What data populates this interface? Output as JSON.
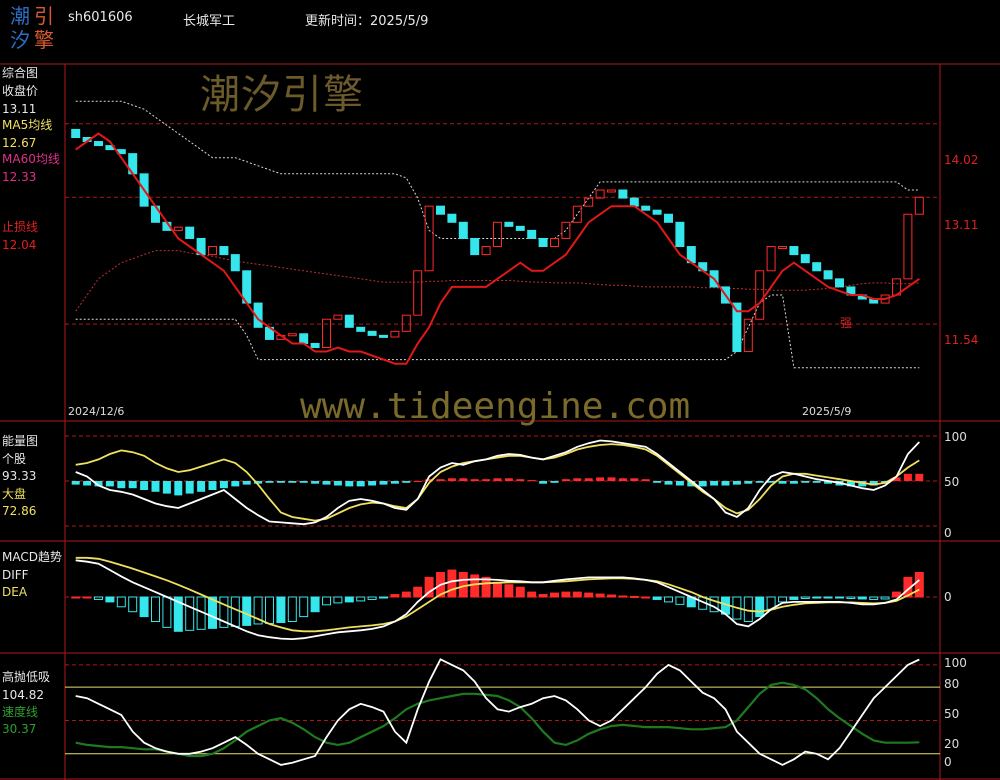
{
  "header": {
    "code": "sh601606",
    "name": "长城军工",
    "update_label": "更新时间：",
    "update_date": "2025/5/9"
  },
  "logo": {
    "chars": [
      "潮",
      "引",
      "汐",
      "擎"
    ]
  },
  "watermark": {
    "brand": "潮汐引擎",
    "url": "www.tideengine.com"
  },
  "panel1": {
    "title": "综合图",
    "close_label": "收盘价",
    "close_value": "13.11",
    "ma5_label": "MA5均线",
    "ma5_value": "12.67",
    "ma60_label": "MA60均线",
    "ma60_value": "12.33",
    "stop_label": "止损线",
    "stop_value": "12.04",
    "strong_marker": "强",
    "date_start": "2024/12/6",
    "date_end": "2025/5/9",
    "axis": [
      "14.02",
      "13.11",
      "11.54"
    ]
  },
  "panel2": {
    "title": "能量图",
    "stock_label": "个股",
    "stock_value": "93.33",
    "market_label": "大盘",
    "market_value": "72.86",
    "axis": [
      "100",
      "50",
      "0"
    ]
  },
  "panel3": {
    "title": "MACD趋势",
    "diff_label": "DIFF",
    "dea_label": "DEA",
    "axis": [
      "0"
    ]
  },
  "panel4": {
    "title": "高抛低吸",
    "value1": "104.82",
    "speed_label": "速度线",
    "speed_value": "30.37",
    "axis": [
      "100",
      "80",
      "50",
      "20",
      "0"
    ]
  },
  "colors": {
    "up": "#ff2a2a",
    "down": "#35e6ec",
    "ma5": "#e01818",
    "ma60": "#c03030",
    "white": "#ffffff",
    "yellow": "#f0e060",
    "green": "#1f7a1f",
    "grid": "#b01818"
  },
  "chart_data": [
    {
      "type": "candlestick",
      "name": "综合图",
      "ylim": [
        10.6,
        14.5
      ],
      "x_range": [
        0,
        64
      ],
      "close": [
        13.85,
        13.8,
        13.75,
        13.7,
        13.65,
        13.4,
        13.0,
        12.8,
        12.7,
        12.74,
        12.6,
        12.4,
        12.5,
        12.4,
        12.2,
        11.8,
        11.5,
        11.35,
        11.4,
        11.42,
        11.3,
        11.25,
        11.6,
        11.65,
        11.5,
        11.45,
        11.4,
        11.38,
        11.45,
        11.65,
        12.2,
        13.0,
        12.9,
        12.8,
        12.6,
        12.4,
        12.5,
        12.8,
        12.75,
        12.7,
        12.6,
        12.5,
        12.6,
        12.8,
        13.0,
        13.1,
        13.2,
        13.2,
        13.1,
        13.0,
        12.95,
        12.9,
        12.8,
        12.5,
        12.3,
        12.2,
        12.0,
        11.8,
        11.2,
        11.6,
        12.2,
        12.5,
        12.5,
        12.4,
        12.3,
        12.2,
        12.1,
        12.0,
        11.9,
        11.85,
        11.8,
        11.9,
        12.1,
        12.9,
        13.11
      ],
      "ma5": [
        13.7,
        13.8,
        13.9,
        13.8,
        13.6,
        13.4,
        13.2,
        13.0,
        12.8,
        12.6,
        12.5,
        12.4,
        12.3,
        12.2,
        12.0,
        11.8,
        11.6,
        11.5,
        11.4,
        11.3,
        11.3,
        11.2,
        11.2,
        11.25,
        11.2,
        11.2,
        11.15,
        11.1,
        11.05,
        11.05,
        11.3,
        11.5,
        11.8,
        12.0,
        12.0,
        12.0,
        12.0,
        12.1,
        12.2,
        12.3,
        12.2,
        12.2,
        12.3,
        12.4,
        12.6,
        12.8,
        12.9,
        13.0,
        13.0,
        13.0,
        12.9,
        12.8,
        12.6,
        12.4,
        12.3,
        12.2,
        12.1,
        11.9,
        11.7,
        11.7,
        11.8,
        12.0,
        12.2,
        12.3,
        12.2,
        12.1,
        12.0,
        11.95,
        11.9,
        11.9,
        11.85,
        11.85,
        11.9,
        12.0,
        12.1
      ],
      "ma60": [
        11.7,
        11.9,
        12.1,
        12.2,
        12.3,
        12.35,
        12.4,
        12.45,
        12.45,
        12.45,
        12.42,
        12.4,
        12.38,
        12.35,
        12.32,
        12.3,
        12.28,
        12.26,
        12.24,
        12.22,
        12.2,
        12.18,
        12.16,
        12.14,
        12.12,
        12.1,
        12.08,
        12.06,
        12.06,
        12.06,
        12.06,
        12.07,
        12.07,
        12.08,
        12.08,
        12.08,
        12.08,
        12.08,
        12.08,
        12.07,
        12.06,
        12.06,
        12.05,
        12.05,
        12.05,
        12.04,
        12.03,
        12.02,
        12.02,
        12.01,
        12.0,
        12.0,
        12.0,
        12.0,
        12.0,
        11.99,
        11.99,
        11.98,
        11.98,
        11.97,
        11.97,
        11.96,
        11.96,
        11.96,
        11.96,
        11.97,
        11.98,
        12.0,
        12.02,
        12.04,
        12.05,
        12.05,
        12.04,
        12.04,
        12.05
      ],
      "upper_band": [
        14.3,
        14.3,
        14.3,
        14.3,
        14.3,
        14.25,
        14.2,
        14.1,
        14.0,
        13.9,
        13.8,
        13.7,
        13.6,
        13.6,
        13.6,
        13.55,
        13.5,
        13.45,
        13.4,
        13.4,
        13.4,
        13.4,
        13.4,
        13.4,
        13.4,
        13.4,
        13.4,
        13.4,
        13.4,
        13.35,
        13.1,
        12.7,
        12.6,
        12.6,
        12.6,
        12.6,
        12.6,
        12.6,
        12.6,
        12.6,
        12.6,
        12.6,
        12.6,
        12.7,
        12.9,
        13.1,
        13.3,
        13.3,
        13.3,
        13.3,
        13.3,
        13.3,
        13.3,
        13.3,
        13.3,
        13.3,
        13.3,
        13.3,
        13.3,
        13.3,
        13.3,
        13.3,
        13.3,
        13.3,
        13.3,
        13.3,
        13.3,
        13.3,
        13.3,
        13.3,
        13.3,
        13.3,
        13.3,
        13.2,
        13.2
      ],
      "lower_band": [
        11.6,
        11.6,
        11.6,
        11.6,
        11.6,
        11.6,
        11.6,
        11.6,
        11.6,
        11.6,
        11.6,
        11.6,
        11.6,
        11.6,
        11.6,
        11.4,
        11.1,
        11.1,
        11.1,
        11.1,
        11.1,
        11.1,
        11.1,
        11.1,
        11.1,
        11.1,
        11.1,
        11.1,
        11.1,
        11.1,
        11.1,
        11.1,
        11.1,
        11.1,
        11.1,
        11.1,
        11.1,
        11.1,
        11.1,
        11.1,
        11.1,
        11.1,
        11.1,
        11.1,
        11.1,
        11.1,
        11.1,
        11.1,
        11.1,
        11.1,
        11.1,
        11.1,
        11.1,
        11.1,
        11.1,
        11.1,
        11.1,
        11.1,
        11.2,
        11.5,
        11.8,
        11.9,
        11.9,
        11.0,
        11.0,
        11.0,
        11.0,
        11.0,
        11.0,
        11.0,
        11.0,
        11.0,
        11.0,
        11.0,
        11.0
      ],
      "axis_ticks": [
        14.02,
        13.11,
        11.54
      ]
    },
    {
      "type": "line+bar",
      "name": "能量图",
      "ylim": [
        0,
        100
      ],
      "stock": [
        60,
        55,
        45,
        40,
        38,
        35,
        30,
        25,
        22,
        20,
        25,
        30,
        35,
        40,
        30,
        20,
        12,
        5,
        4,
        3,
        2,
        4,
        10,
        20,
        28,
        30,
        28,
        25,
        20,
        18,
        30,
        55,
        65,
        70,
        68,
        72,
        74,
        78,
        80,
        79,
        76,
        74,
        78,
        82,
        88,
        92,
        95,
        94,
        92,
        90,
        88,
        80,
        70,
        60,
        50,
        40,
        30,
        15,
        10,
        20,
        40,
        55,
        60,
        58,
        55,
        52,
        50,
        48,
        45,
        42,
        40,
        45,
        55,
        80,
        93.33
      ],
      "market": [
        68,
        70,
        74,
        80,
        84,
        82,
        78,
        70,
        64,
        60,
        62,
        66,
        70,
        74,
        70,
        60,
        46,
        30,
        15,
        10,
        8,
        6,
        8,
        14,
        20,
        24,
        26,
        25,
        22,
        20,
        30,
        48,
        60,
        66,
        70,
        72,
        74,
        76,
        78,
        78,
        76,
        74,
        76,
        80,
        85,
        88,
        90,
        91,
        90,
        88,
        85,
        78,
        68,
        58,
        48,
        38,
        30,
        20,
        14,
        18,
        30,
        45,
        55,
        58,
        58,
        56,
        54,
        52,
        50,
        48,
        46,
        48,
        55,
        65,
        72.86
      ],
      "histogram": [
        -4,
        -5,
        -6,
        -6,
        -8,
        -8,
        -10,
        -12,
        -14,
        -16,
        -14,
        -12,
        -10,
        -8,
        -6,
        -4,
        -3,
        -2,
        -2,
        -2,
        -2,
        -3,
        -4,
        -5,
        -6,
        -6,
        -5,
        -4,
        -3,
        -2,
        0,
        2,
        2,
        3,
        3,
        2,
        2,
        3,
        3,
        2,
        1,
        -3,
        -2,
        2,
        3,
        3,
        4,
        4,
        3,
        3,
        2,
        -2,
        -4,
        -5,
        -6,
        -6,
        -5,
        -5,
        -4,
        -3,
        -2,
        -2,
        -3,
        -3,
        -2,
        -2,
        -3,
        -5,
        -6,
        -6,
        -5,
        -3,
        4,
        8,
        8
      ],
      "axis_ticks": [
        100,
        50,
        0
      ]
    },
    {
      "type": "macd",
      "name": "MACD趋势",
      "ylim": [
        -1.0,
        1.0
      ],
      "diff": [
        0.75,
        0.72,
        0.68,
        0.55,
        0.42,
        0.3,
        0.2,
        0.1,
        0.0,
        -0.1,
        -0.2,
        -0.3,
        -0.4,
        -0.5,
        -0.6,
        -0.7,
        -0.78,
        -0.82,
        -0.85,
        -0.86,
        -0.84,
        -0.8,
        -0.76,
        -0.72,
        -0.7,
        -0.68,
        -0.65,
        -0.6,
        -0.5,
        -0.35,
        -0.1,
        0.1,
        0.25,
        0.32,
        0.35,
        0.36,
        0.36,
        0.35,
        0.33,
        0.32,
        0.3,
        0.3,
        0.33,
        0.36,
        0.38,
        0.4,
        0.4,
        0.4,
        0.4,
        0.38,
        0.35,
        0.3,
        0.2,
        0.1,
        0.0,
        -0.1,
        -0.2,
        -0.35,
        -0.55,
        -0.6,
        -0.45,
        -0.25,
        -0.12,
        -0.1,
        -0.1,
        -0.1,
        -0.1,
        -0.1,
        -0.12,
        -0.15,
        -0.15,
        -0.12,
        -0.05,
        0.15,
        0.35
      ],
      "dea": [
        0.8,
        0.8,
        0.78,
        0.72,
        0.65,
        0.58,
        0.5,
        0.42,
        0.34,
        0.25,
        0.15,
        0.05,
        -0.05,
        -0.15,
        -0.25,
        -0.35,
        -0.45,
        -0.55,
        -0.62,
        -0.68,
        -0.7,
        -0.7,
        -0.68,
        -0.65,
        -0.62,
        -0.6,
        -0.58,
        -0.55,
        -0.5,
        -0.4,
        -0.25,
        -0.1,
        0.05,
        0.15,
        0.22,
        0.26,
        0.28,
        0.29,
        0.3,
        0.3,
        0.3,
        0.3,
        0.31,
        0.32,
        0.34,
        0.36,
        0.37,
        0.38,
        0.38,
        0.37,
        0.35,
        0.32,
        0.26,
        0.18,
        0.1,
        0.0,
        -0.08,
        -0.15,
        -0.22,
        -0.28,
        -0.3,
        -0.26,
        -0.2,
        -0.16,
        -0.13,
        -0.12,
        -0.11,
        -0.11,
        -0.11,
        -0.12,
        -0.13,
        -0.12,
        -0.08,
        0.03,
        0.15
      ],
      "histogram": [
        0.0,
        0.0,
        -0.05,
        -0.1,
        -0.2,
        -0.3,
        -0.4,
        -0.5,
        -0.62,
        -0.7,
        -0.68,
        -0.66,
        -0.64,
        -0.62,
        -0.6,
        -0.58,
        -0.55,
        -0.54,
        -0.52,
        -0.5,
        -0.4,
        -0.3,
        -0.16,
        -0.12,
        -0.1,
        -0.08,
        -0.05,
        -0.02,
        0.05,
        0.1,
        0.2,
        0.4,
        0.5,
        0.55,
        0.5,
        0.45,
        0.4,
        0.3,
        0.25,
        0.2,
        0.1,
        0.05,
        0.08,
        0.1,
        0.1,
        0.08,
        0.06,
        0.04,
        0.02,
        0.01,
        0.0,
        -0.05,
        -0.1,
        -0.15,
        -0.2,
        -0.25,
        -0.3,
        -0.35,
        -0.45,
        -0.5,
        -0.4,
        -0.25,
        -0.1,
        -0.05,
        -0.03,
        -0.02,
        -0.02,
        -0.02,
        -0.03,
        -0.04,
        -0.05,
        -0.04,
        0.1,
        0.4,
        0.5
      ],
      "axis_ticks": [
        0
      ]
    },
    {
      "type": "line",
      "name": "高抛低吸",
      "ylim": [
        0,
        108
      ],
      "value": [
        72,
        70,
        65,
        60,
        55,
        40,
        30,
        25,
        22,
        20,
        20,
        22,
        25,
        30,
        35,
        28,
        20,
        15,
        10,
        12,
        15,
        18,
        35,
        50,
        60,
        65,
        62,
        58,
        40,
        30,
        60,
        85,
        105,
        100,
        95,
        85,
        70,
        60,
        58,
        62,
        65,
        70,
        72,
        68,
        60,
        50,
        45,
        50,
        60,
        70,
        80,
        92,
        100,
        95,
        85,
        75,
        70,
        60,
        40,
        30,
        20,
        15,
        10,
        15,
        22,
        20,
        15,
        25,
        40,
        55,
        70,
        80,
        90,
        100,
        104.82
      ],
      "speed": [
        30,
        28,
        27,
        26,
        26,
        25,
        24,
        24,
        22,
        20,
        18,
        18,
        20,
        25,
        32,
        40,
        45,
        50,
        52,
        48,
        42,
        35,
        30,
        28,
        30,
        35,
        40,
        45,
        52,
        60,
        65,
        68,
        70,
        72,
        74,
        74,
        73,
        72,
        68,
        62,
        52,
        40,
        30,
        28,
        32,
        38,
        42,
        45,
        46,
        45,
        44,
        44,
        44,
        43,
        42,
        42,
        43,
        44,
        50,
        62,
        74,
        82,
        84,
        82,
        78,
        70,
        60,
        52,
        45,
        38,
        32,
        30,
        30,
        30,
        30.37
      ],
      "axis_ticks": [
        100,
        80,
        50,
        20,
        0
      ]
    }
  ]
}
